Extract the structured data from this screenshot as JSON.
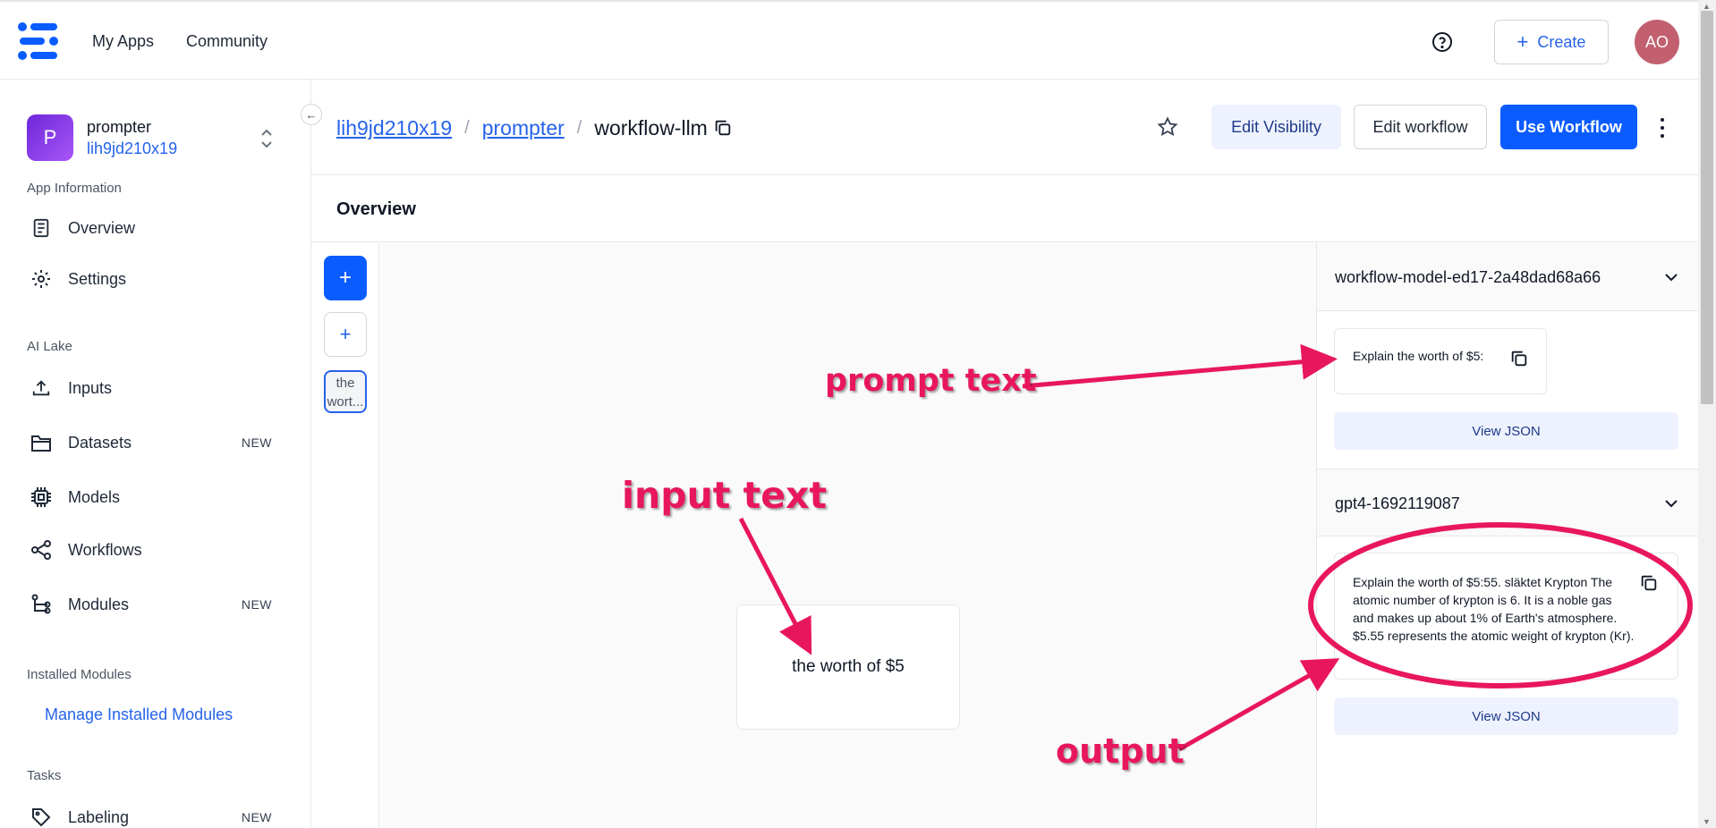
{
  "topnav": {
    "brand_icon": "clarifai-logo-icon",
    "links": [
      "My Apps",
      "Community"
    ],
    "create_label": "Create",
    "avatar_initials": "AO",
    "help_icon": "help-circle-icon",
    "avatar_color": "#c2606f"
  },
  "sidebar": {
    "app": {
      "badge": "P",
      "name": "prompter",
      "owner": "lih9jd210x19"
    },
    "sections": [
      {
        "label": "App Information",
        "items": [
          {
            "label": "Overview",
            "icon": "document-icon"
          },
          {
            "label": "Settings",
            "icon": "gear-icon"
          }
        ]
      },
      {
        "label": "AI Lake",
        "items": [
          {
            "label": "Inputs",
            "icon": "upload-icon"
          },
          {
            "label": "Datasets",
            "icon": "folder-icon",
            "badge": "NEW"
          },
          {
            "label": "Models",
            "icon": "chip-icon"
          },
          {
            "label": "Workflows",
            "icon": "share-icon"
          },
          {
            "label": "Modules",
            "icon": "modules-icon",
            "badge": "NEW"
          }
        ]
      },
      {
        "label": "Installed Modules",
        "link": "Manage Installed Modules"
      },
      {
        "label": "Tasks",
        "items": [
          {
            "label": "Labeling",
            "icon": "tag-icon",
            "badge": "NEW"
          }
        ]
      }
    ]
  },
  "header": {
    "breadcrumbs": [
      "lih9jd210x19",
      "prompter",
      "workflow-llm"
    ],
    "separator": "/",
    "buttons": {
      "visibility": "Edit Visibility",
      "edit": "Edit workflow",
      "use": "Use Workflow"
    },
    "accent_color": "#0b5cff"
  },
  "overview": {
    "title": "Overview"
  },
  "canvas": {
    "thumbnail_text": "the wort...",
    "input_text": "the worth of $5"
  },
  "results": [
    {
      "model_id": "workflow-model-ed17-2a48dad68a66",
      "output": "Explain the worth of $5:",
      "json_label": "View JSON"
    },
    {
      "model_id": "gpt4-1692119087",
      "output": "Explain the worth of $5:55. släktet Krypton The atomic number of krypton is 6. It is a noble gas and makes up about 1% of Earth's atmosphere. $5.55 represents the atomic weight of krypton (Kr).",
      "json_label": "View JSON"
    }
  ],
  "annotations": {
    "prompt": "prompt text",
    "input": "input text",
    "output": "output",
    "color": "#e8175d"
  }
}
